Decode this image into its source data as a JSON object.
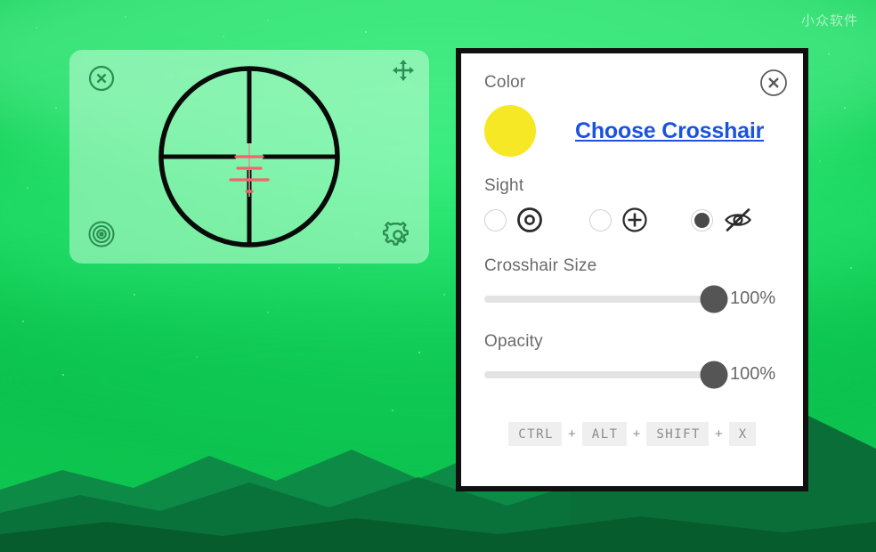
{
  "desktop": {
    "watermark": "小众软件",
    "background_color": "#12cf58",
    "mountain_color": "#0a7a3c"
  },
  "crosshair_widget": {
    "close_icon": "close-circle-icon",
    "move_icon": "move-arrows-icon",
    "target_icon": "bullseye-target-icon",
    "gear_icon": "gear-icon",
    "reticle_color": "#000000",
    "reticle_accent_color": "#f4626b"
  },
  "panel": {
    "close_icon": "close-circle-icon",
    "color": {
      "label": "Color",
      "swatch_color": "#f6e824",
      "choose_link": "Choose Crosshair",
      "link_color": "#1a53e0"
    },
    "sight": {
      "label": "Sight",
      "options": [
        {
          "icon": "dot-in-circle-icon",
          "selected": false
        },
        {
          "icon": "plus-in-circle-icon",
          "selected": false
        },
        {
          "icon": "eye-slash-icon",
          "selected": true
        }
      ]
    },
    "sliders": [
      {
        "label": "Crosshair Size",
        "value": 100,
        "display": "100%"
      },
      {
        "label": "Opacity",
        "value": 100,
        "display": "100%"
      }
    ],
    "shortcut": {
      "keys": [
        "CTRL",
        "ALT",
        "SHIFT",
        "X"
      ],
      "separator": "+"
    }
  }
}
